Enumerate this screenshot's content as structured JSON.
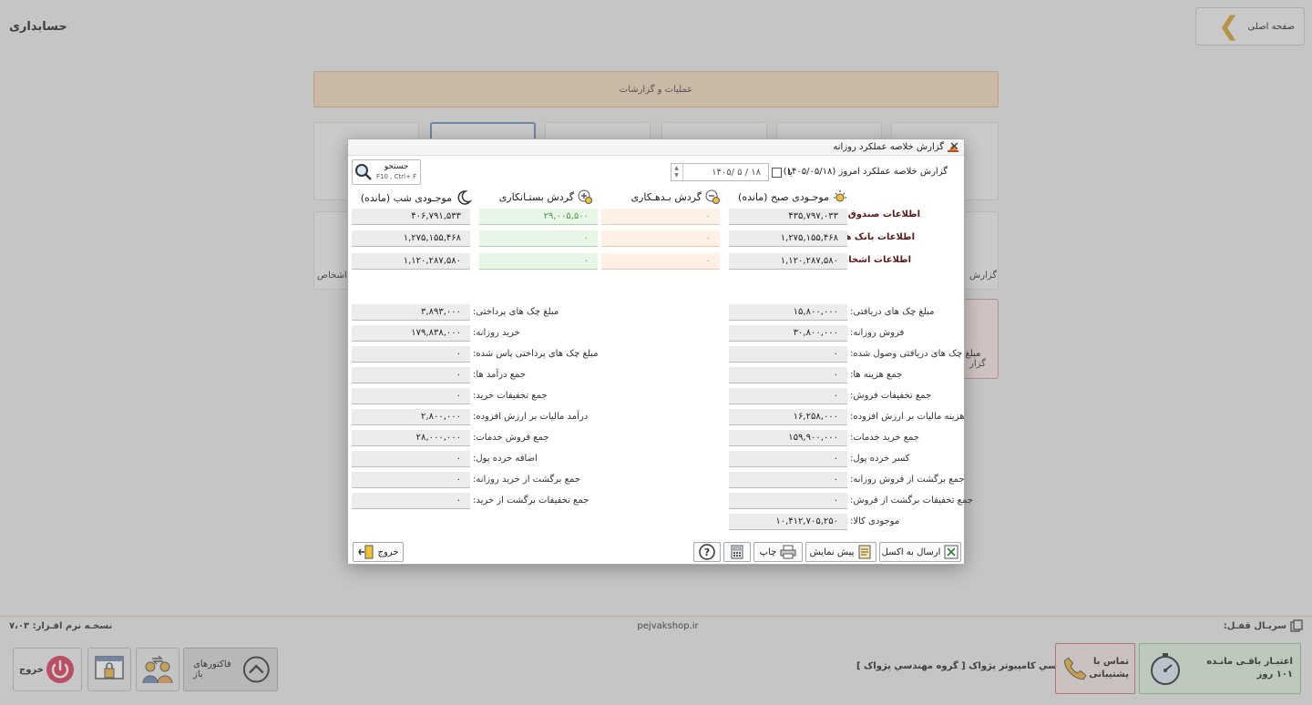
{
  "app": {
    "title": "حسابداری",
    "home_label": "صفحه اصلی",
    "section_title": "عملیات و گزارشات",
    "bg_left_text": "اشخاص",
    "bg_right_text1": "گزارش",
    "bg_right_text2": "گزار"
  },
  "dialog": {
    "title": "گزارش خلاصه عملکرد روزانه",
    "report_label": "گزارش خلاصه عملکرد امروز",
    "today_date": "(۱۴۰۵/۰۵/۱۸)",
    "or_label": "یا",
    "date_value": "۱۴۰۵/ ۵ / ۱۸",
    "search": {
      "label": "جستجو",
      "shortcut": "F10 , Ctrl+ F"
    },
    "columns": {
      "morning": "موجـودی صبح (مانده)",
      "debit": "گردش بـدهـکاری",
      "credit": "گردش بستـانکاری",
      "night": "موجـودی شب (مانده)"
    },
    "rows": [
      {
        "label": "اطلاعات صندوق ها:",
        "morning": "۴۳۵,۷۹۷,۰۳۳",
        "debit": "۰",
        "credit": "۲۹,۰۰۵,۵۰۰",
        "night": "۴۰۶,۷۹۱,۵۳۳"
      },
      {
        "label": "اطلاعات بانک ها :",
        "morning": "۱,۲۷۵,۱۵۵,۴۶۸",
        "debit": "۰",
        "credit": "۰",
        "night": "۱,۲۷۵,۱۵۵,۴۶۸"
      },
      {
        "label": "اطلاعات اشخاص:",
        "morning": "۱,۱۲۰,۲۸۷,۵۸۰",
        "debit": "۰",
        "credit": "۰",
        "night": "۱,۱۲۰,۲۸۷,۵۸۰"
      }
    ],
    "right_fields": [
      {
        "label": "مبلغ چک های دریافتی:",
        "value": "۱۵,۸۰۰,۰۰۰"
      },
      {
        "label": "فروش روزانه:",
        "value": "۳۰,۸۰۰,۰۰۰"
      },
      {
        "label": "مبلغ چک های دریافتی وصول شده:",
        "value": "۰"
      },
      {
        "label": "جمع هزینه ها:",
        "value": "۰"
      },
      {
        "label": "جمع تخفیفات فروش:",
        "value": "۰"
      },
      {
        "label": "هزینه مالیات بر ارزش افزوده:",
        "value": "۱۶,۲۵۸,۰۰۰"
      },
      {
        "label": "جمع خرید خدمات:",
        "value": "۱۵۹,۹۰۰,۰۰۰"
      },
      {
        "label": "کسر خرده پول:",
        "value": "۰"
      },
      {
        "label": "جمع برگشت از فروش روزانه:",
        "value": "۰"
      },
      {
        "label": "جمع تخفیفات برگشت از فروش:",
        "value": "۰"
      },
      {
        "label": "موجودی کالا:",
        "value": "۱۰,۴۱۲,۷۰۵,۲۵۰"
      }
    ],
    "left_fields": [
      {
        "label": "مبلغ چک های پرداختی:",
        "value": "۳,۸۹۳,۰۰۰"
      },
      {
        "label": "خرید روزانه:",
        "value": "۱۷۹,۸۳۸,۰۰۰"
      },
      {
        "label": "مبلغ چک های پرداختی پاس شده:",
        "value": "۰"
      },
      {
        "label": "جمع درآمد ها:",
        "value": "۰"
      },
      {
        "label": "جمع تخفیفات خرید:",
        "value": "۰"
      },
      {
        "label": "درآمد مالیات بر ارزش افزوده:",
        "value": "۲,۸۰۰,۰۰۰"
      },
      {
        "label": "جمع فروش خدمات:",
        "value": "۲۸,۰۰۰,۰۰۰"
      },
      {
        "label": "اضافه خرده پول:",
        "value": "۰"
      },
      {
        "label": "جمع برگشت از خرید روزانه:",
        "value": "۰"
      },
      {
        "label": "جمع تخفیفات برگشت از خرید:",
        "value": "۰"
      }
    ],
    "toolbar": {
      "excel": "ارسال به اکسل",
      "preview": "پیش نمایش",
      "print": "چاپ",
      "exit": "خروج"
    }
  },
  "footer": {
    "serial_label": "سریـال قفـل:",
    "website": "pejvakshop.ir",
    "version": "نسخـه نرم افـزار: ۷،۰۳",
    "company": "شرکت مهندسي کامپيوتر پژواک [ گروه مهندسي پژواک ]",
    "support_line1": "تماس با",
    "support_line2": "پشتیبانی",
    "credit_line1": "اعتبـار باقـی مانـده",
    "credit_line2": "۱۰۱ روز",
    "open_factors": "فاکتورهای باز",
    "exit": "خروج"
  },
  "colors": {
    "accent_orange": "#d5a12b",
    "section_bg": "#efd8bd",
    "row_label": "#5a1a1a"
  }
}
